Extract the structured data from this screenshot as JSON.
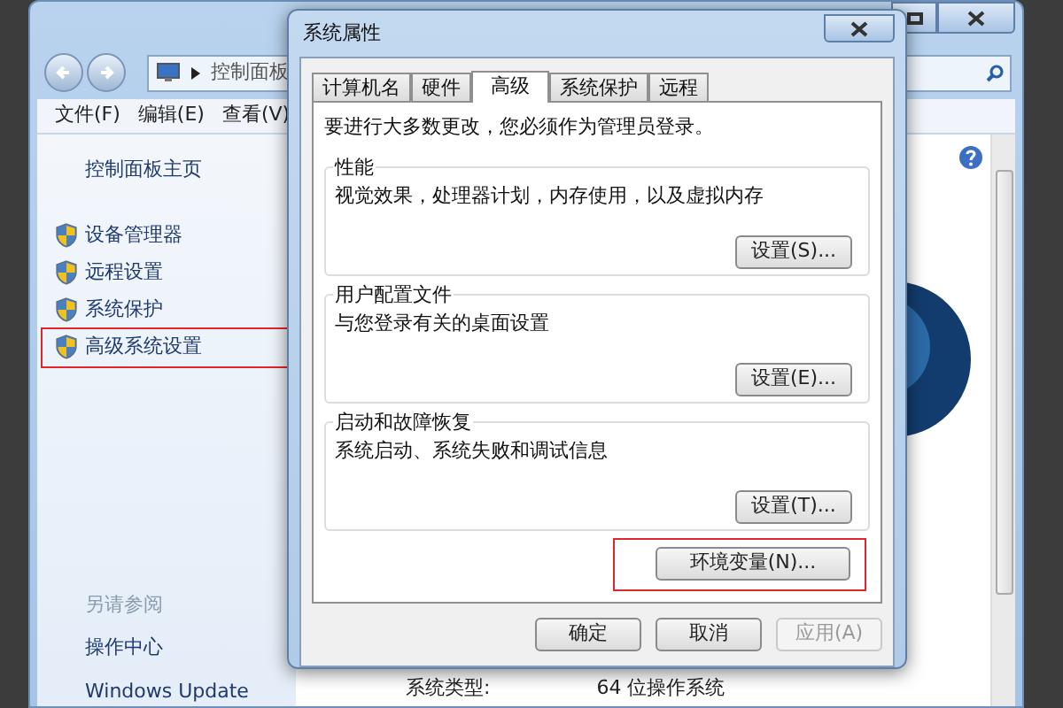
{
  "explorer": {
    "breadcrumb": "控制面板",
    "menu": [
      "文件(F)",
      "编辑(E)",
      "查看(V)"
    ],
    "sidebar": {
      "home": "控制面板主页",
      "items": [
        {
          "label": "设备管理器",
          "highlighted": false
        },
        {
          "label": "远程设置",
          "highlighted": false
        },
        {
          "label": "系统保护",
          "highlighted": false
        },
        {
          "label": "高级系统设置",
          "highlighted": true
        }
      ],
      "see_also": {
        "heading": "另请参阅",
        "links": [
          "操作中心",
          "Windows Update"
        ]
      }
    },
    "info": {
      "label": "系统类型:",
      "value": "64 位操作系统"
    }
  },
  "dialog": {
    "title": "系统属性",
    "tabs": [
      {
        "label": "计算机名",
        "selected": false
      },
      {
        "label": "硬件",
        "selected": false
      },
      {
        "label": "高级",
        "selected": true
      },
      {
        "label": "系统保护",
        "selected": false
      },
      {
        "label": "远程",
        "selected": false
      }
    ],
    "notice": "要进行大多数更改，您必须作为管理员登录。",
    "groups": [
      {
        "title": "性能",
        "description": "视觉效果，处理器计划，内存使用，以及虚拟内存",
        "button": "设置(S)..."
      },
      {
        "title": "用户配置文件",
        "description": "与您登录有关的桌面设置",
        "button": "设置(E)..."
      },
      {
        "title": "启动和故障恢复",
        "description": "系统启动、系统失败和调试信息",
        "button": "设置(T)..."
      }
    ],
    "env_button": {
      "label": "环境变量(N)...",
      "highlighted": true
    },
    "footer": [
      {
        "label": "确定",
        "disabled": false
      },
      {
        "label": "取消",
        "disabled": false
      },
      {
        "label": "应用(A)",
        "disabled": true
      }
    ]
  }
}
